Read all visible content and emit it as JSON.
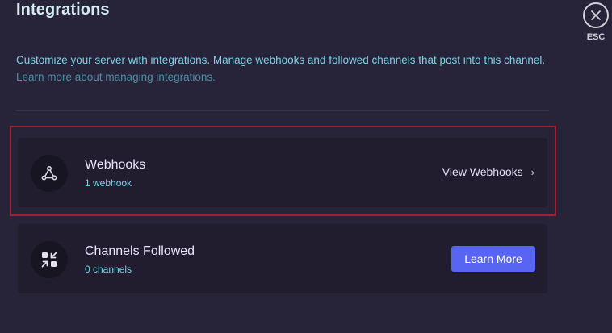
{
  "header": {
    "title": "Integrations",
    "close_label": "ESC"
  },
  "description": {
    "text": "Customize your server with integrations. Manage webhooks and followed channels that post into this channel.",
    "link_text": "Learn more about managing integrations."
  },
  "webhooks": {
    "title": "Webhooks",
    "subtitle": "1 webhook",
    "action_label": "View Webhooks",
    "action_chevron": "›",
    "icon": "webhook-icon"
  },
  "channels": {
    "title": "Channels Followed",
    "subtitle": "0 channels",
    "action_label": "Learn More",
    "icon": "channel-follow-icon"
  },
  "colors": {
    "background": "#272338",
    "card": "#211d2f",
    "accent_button": "#5865f2",
    "highlight_border": "#a32031",
    "description_text": "#7fd0e6"
  }
}
